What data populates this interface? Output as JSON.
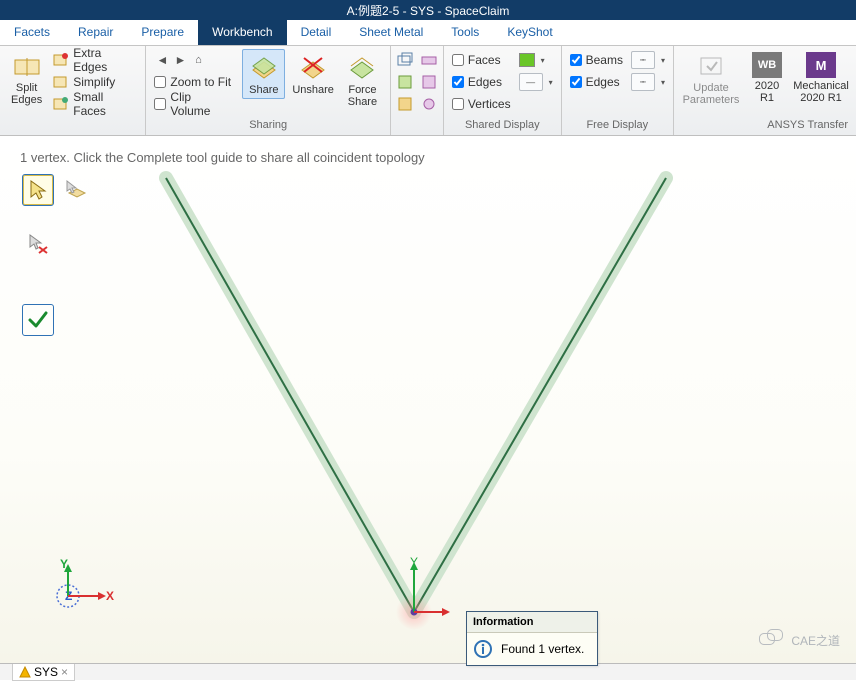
{
  "title": "A:例题2-5 - SYS - SpaceClaim",
  "tabs": [
    "Facets",
    "Repair",
    "Prepare",
    "Workbench",
    "Detail",
    "Sheet Metal",
    "Tools",
    "KeyShot"
  ],
  "activeTab": "Workbench",
  "ribbon": {
    "group1": {
      "splitEdges": "Split\nEdges",
      "extraEdges": "Extra Edges",
      "simplify": "Simplify",
      "smallFaces": "Small Faces"
    },
    "group2": {
      "nav": {
        "zoomFit": "Zoom to Fit",
        "clipVol": "Clip Volume"
      },
      "label": "Sharing",
      "share": "Share",
      "unshare": "Unshare",
      "forceShare": "Force\nShare"
    },
    "group3": {
      "label": "Shared Display",
      "faces": "Faces",
      "edges": "Edges",
      "vertices": "Vertices"
    },
    "group4": {
      "label": "Free Display",
      "beams": "Beams",
      "edges": "Edges"
    },
    "group5": {
      "label": "ANSYS Transfer",
      "update": "Update\nParameters",
      "r1": "2020\nR1",
      "mech": "Mechanical\n2020 R1"
    }
  },
  "canvas": {
    "hint": "1 vertex. Click the Complete tool guide to share all coincident topology",
    "info_title": "Information",
    "info_body": "Found 1 vertex."
  },
  "bottomTab": "SYS",
  "watermark": "CAE之道"
}
